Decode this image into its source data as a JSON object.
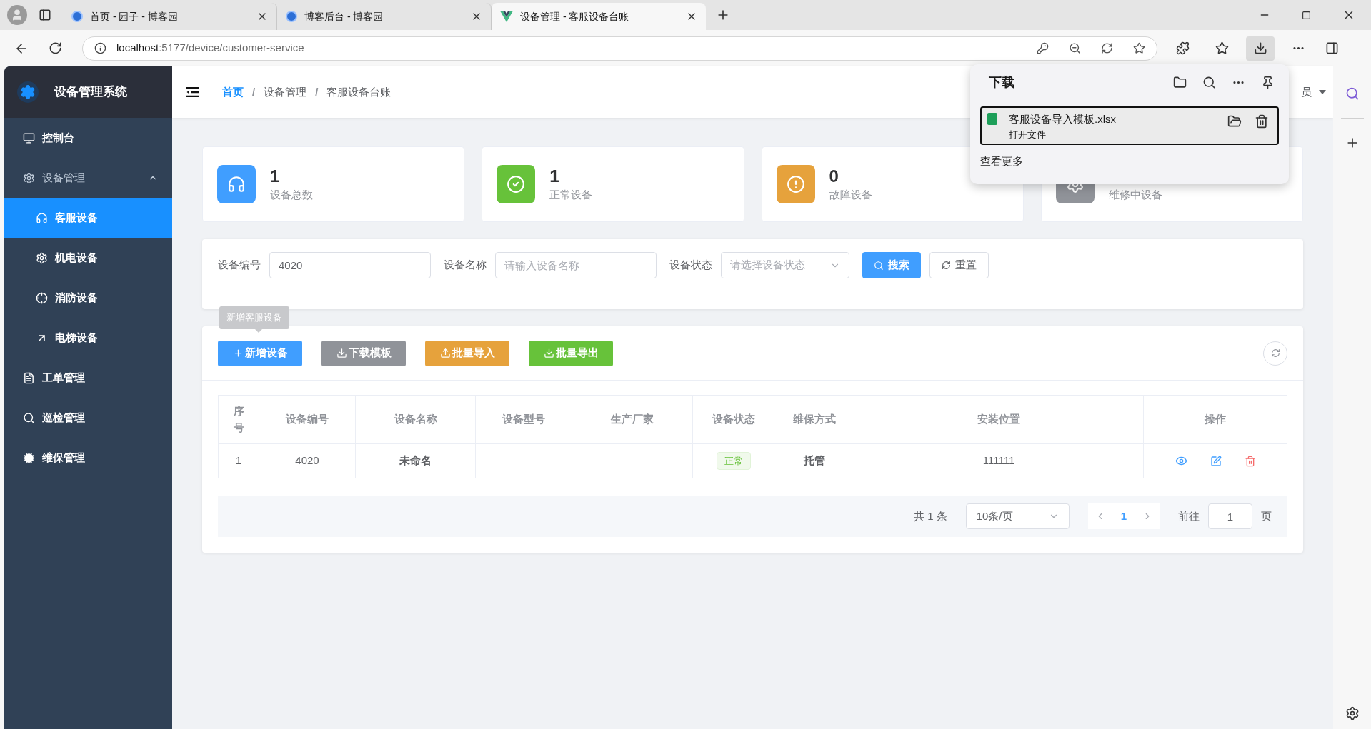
{
  "browser": {
    "tabs": [
      {
        "title": "首页 - 园子 - 博客园",
        "selected": false
      },
      {
        "title": "博客后台 - 博客园",
        "selected": false
      },
      {
        "title": "设备管理 - 客服设备台账",
        "selected": true
      }
    ],
    "url_host": "localhost",
    "url_path": ":5177/device/customer-service"
  },
  "sidebar": {
    "title": "设备管理系统",
    "items": [
      {
        "label": "控制台",
        "selected": false
      },
      {
        "label": "设备管理",
        "selected": false,
        "expanded": true,
        "children": [
          {
            "label": "客服设备",
            "selected": true
          },
          {
            "label": "机电设备",
            "selected": false
          },
          {
            "label": "消防设备",
            "selected": false
          },
          {
            "label": "电梯设备",
            "selected": false
          }
        ]
      },
      {
        "label": "工单管理",
        "selected": false
      },
      {
        "label": "巡检管理",
        "selected": false
      },
      {
        "label": "维保管理",
        "selected": false
      }
    ]
  },
  "breadcrumb": [
    {
      "label": "首页",
      "selected": true
    },
    {
      "label": "设备管理",
      "selected": false
    },
    {
      "label": "客服设备台账",
      "selected": false
    }
  ],
  "breadcrumb_separator": "/",
  "user_menu": "员",
  "stats": [
    {
      "value": "1",
      "label": "设备总数",
      "color": "#409eff"
    },
    {
      "value": "1",
      "label": "正常设备",
      "color": "#67c23a"
    },
    {
      "value": "0",
      "label": "故障设备",
      "color": "#e6a23c"
    },
    {
      "label": "维修中设备",
      "color": "#909399"
    }
  ],
  "filters": [
    {
      "label": "设备编号",
      "kind": "input",
      "value": "4020"
    },
    {
      "label": "设备名称",
      "kind": "input",
      "placeholder": "请输入设备名称"
    },
    {
      "label": "设备状态",
      "kind": "select",
      "placeholder": "请选择设备状态"
    }
  ],
  "filter_buttons": [
    {
      "label": "搜索",
      "kind": "primary"
    },
    {
      "label": "重置",
      "kind": "plain"
    }
  ],
  "toolbar": {
    "buttons": [
      {
        "label": "新增设备",
        "color": "#409eff",
        "kind": "add"
      },
      {
        "label": "下载模板",
        "color": "#909399",
        "kind": "download"
      },
      {
        "label": "批量导入",
        "color": "#e6a23c",
        "kind": "upload"
      },
      {
        "label": "批量导出",
        "color": "#67c23a",
        "kind": "download"
      }
    ],
    "tooltip": "新增客服设备"
  },
  "table": {
    "columns": [
      "序号",
      "设备编号",
      "设备名称",
      "设备型号",
      "生产厂家",
      "设备状态",
      "维保方式",
      "安装位置",
      "操作"
    ],
    "rows": [
      {
        "index": "1",
        "code": "4020",
        "name": "未命名",
        "status": "正常",
        "maintenance": "托管",
        "location": "111111"
      }
    ]
  },
  "pagination": {
    "total": "共 1 条",
    "page_size": "10条/页",
    "pages": [
      {
        "label": "1",
        "selected": true
      }
    ],
    "goto_label": "前往",
    "goto_value": "1",
    "goto_suffix": "页"
  },
  "downloads": {
    "title": "下载",
    "files": [
      {
        "name": "客服设备导入模板.xlsx",
        "action": "打开文件"
      }
    ],
    "more": "查看更多"
  }
}
